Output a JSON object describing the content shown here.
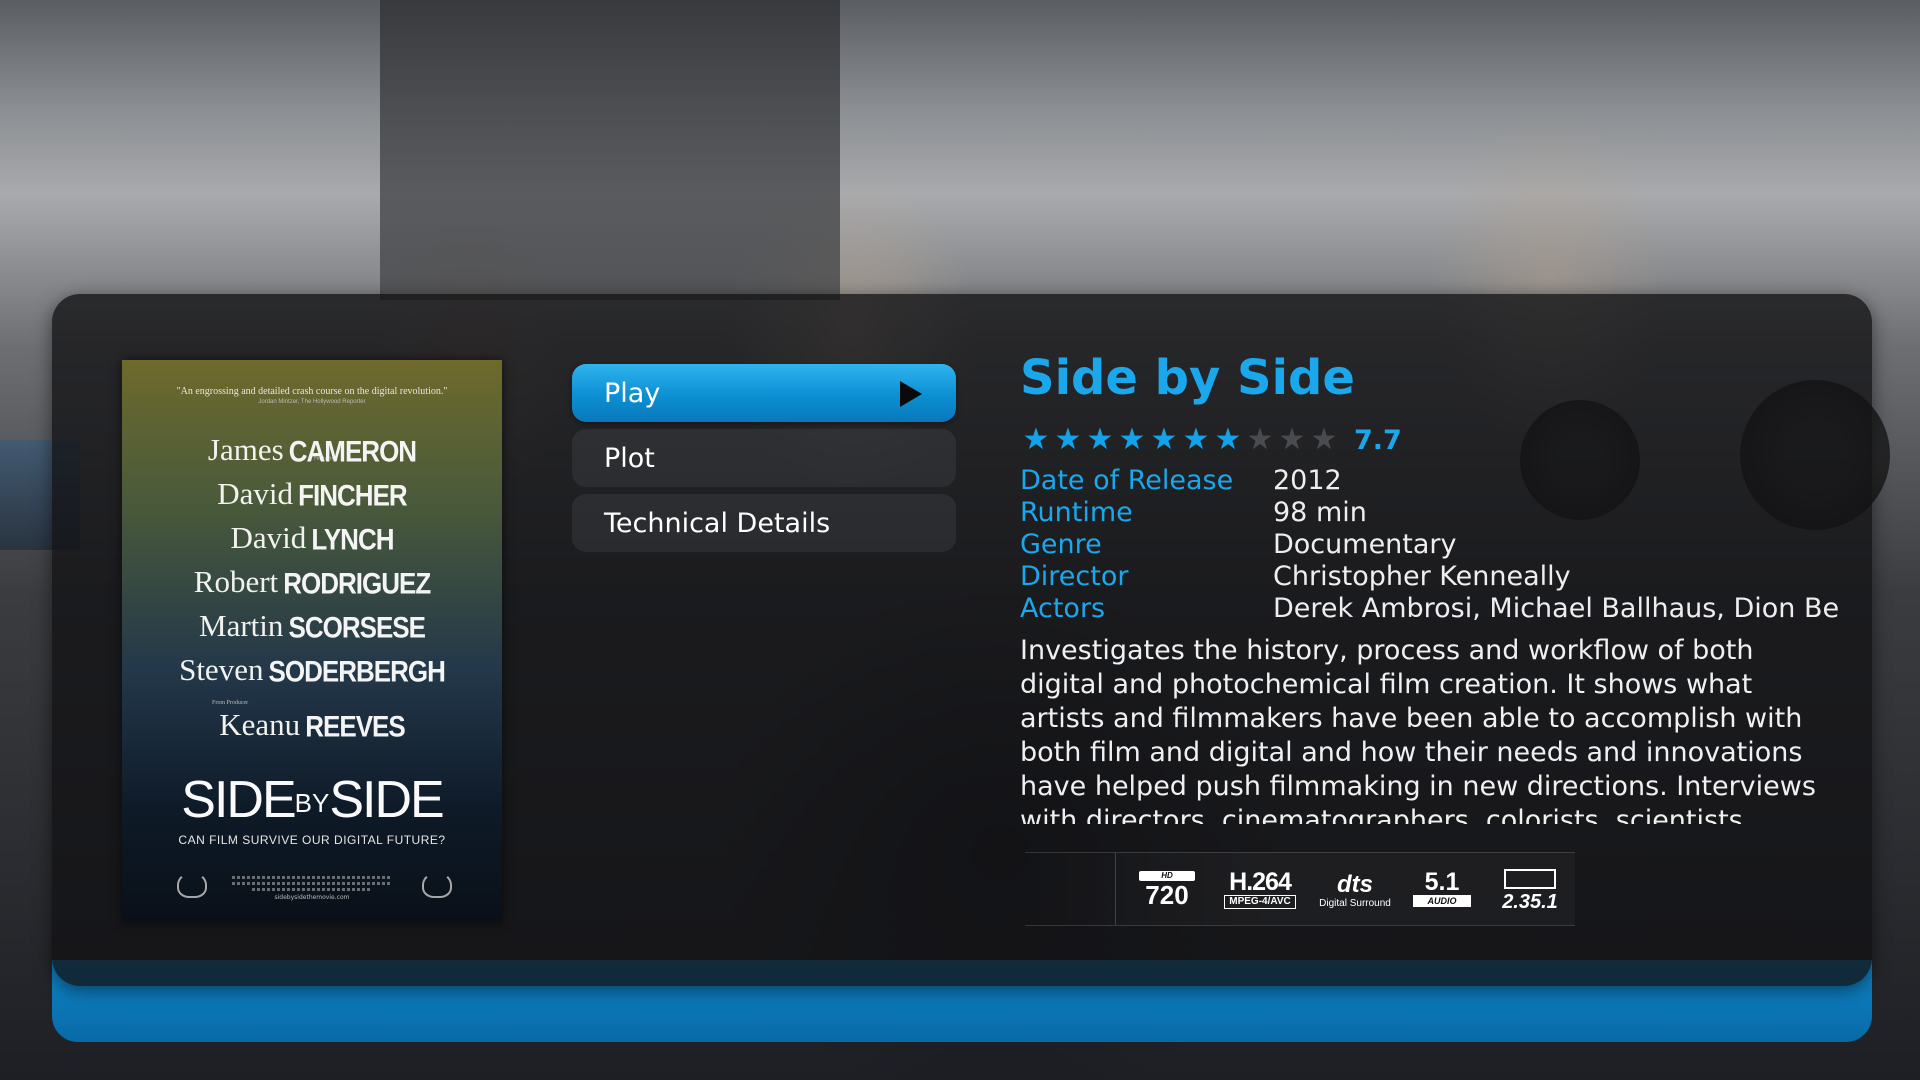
{
  "movie": {
    "title": "Side by Side",
    "rating_value": "7.7",
    "rating_stars": 7.7,
    "rating_max": 10
  },
  "menu": {
    "items": [
      {
        "label": "Play",
        "focused": true
      },
      {
        "label": "Plot",
        "focused": false
      },
      {
        "label": "Technical Details",
        "focused": false
      }
    ]
  },
  "info": {
    "rows": [
      {
        "label": "Date of Release",
        "value": "2012"
      },
      {
        "label": "Runtime",
        "value": "98 min"
      },
      {
        "label": "Genre",
        "value": "Documentary"
      },
      {
        "label": "Director",
        "value": "Christopher Kenneally"
      },
      {
        "label": "Actors",
        "value": "Derek Ambrosi, Michael Ballhaus, Dion Beebe"
      }
    ]
  },
  "plot": "Investigates the history, process and workflow of both digital and photochemical film creation. It shows what artists and filmmakers have been able to accomplish with both film and digital and how their needs and innovations have helped push filmmaking in new directions. Interviews with directors, cinematographers, colorists, scientists, engineers and artists",
  "poster": {
    "quote": "\"An engrossing and detailed crash course on the digital revolution.\"",
    "quote_source": "Jordan Mintzer, The Hollywood Reporter",
    "featuring_label": "Featuring",
    "producer_label": "From Producer",
    "names": [
      {
        "first": "James",
        "last": "CAMERON"
      },
      {
        "first": "David",
        "last": "FINCHER"
      },
      {
        "first": "David",
        "last": "LYNCH"
      },
      {
        "first": "Robert",
        "last": "RODRIGUEZ"
      },
      {
        "first": "Martin",
        "last": "SCORSESE"
      },
      {
        "first": "Steven",
        "last": "SODERBERGH"
      },
      {
        "first": "Keanu",
        "last": "REEVES"
      }
    ],
    "logo_left": "SIDE",
    "logo_by": "BY",
    "logo_right": "SIDE",
    "tagline": "CAN FILM SURVIVE OUR DIGITAL FUTURE?",
    "url": "sidebysidethemovie.com"
  },
  "media_flags": {
    "hd_label": "HD",
    "resolution": "720",
    "codec": "H.264",
    "codec_sub": "MPEG-4/AVC",
    "audio_brand": "dts",
    "audio_sub": "Digital Surround",
    "channels": "5.1",
    "channels_sub": "AUDIO",
    "aspect": "2.35.1"
  },
  "colors": {
    "accent": "#1aa7ec",
    "focus": "#0c8fd3",
    "bottom_bar": "#0a78b8"
  }
}
